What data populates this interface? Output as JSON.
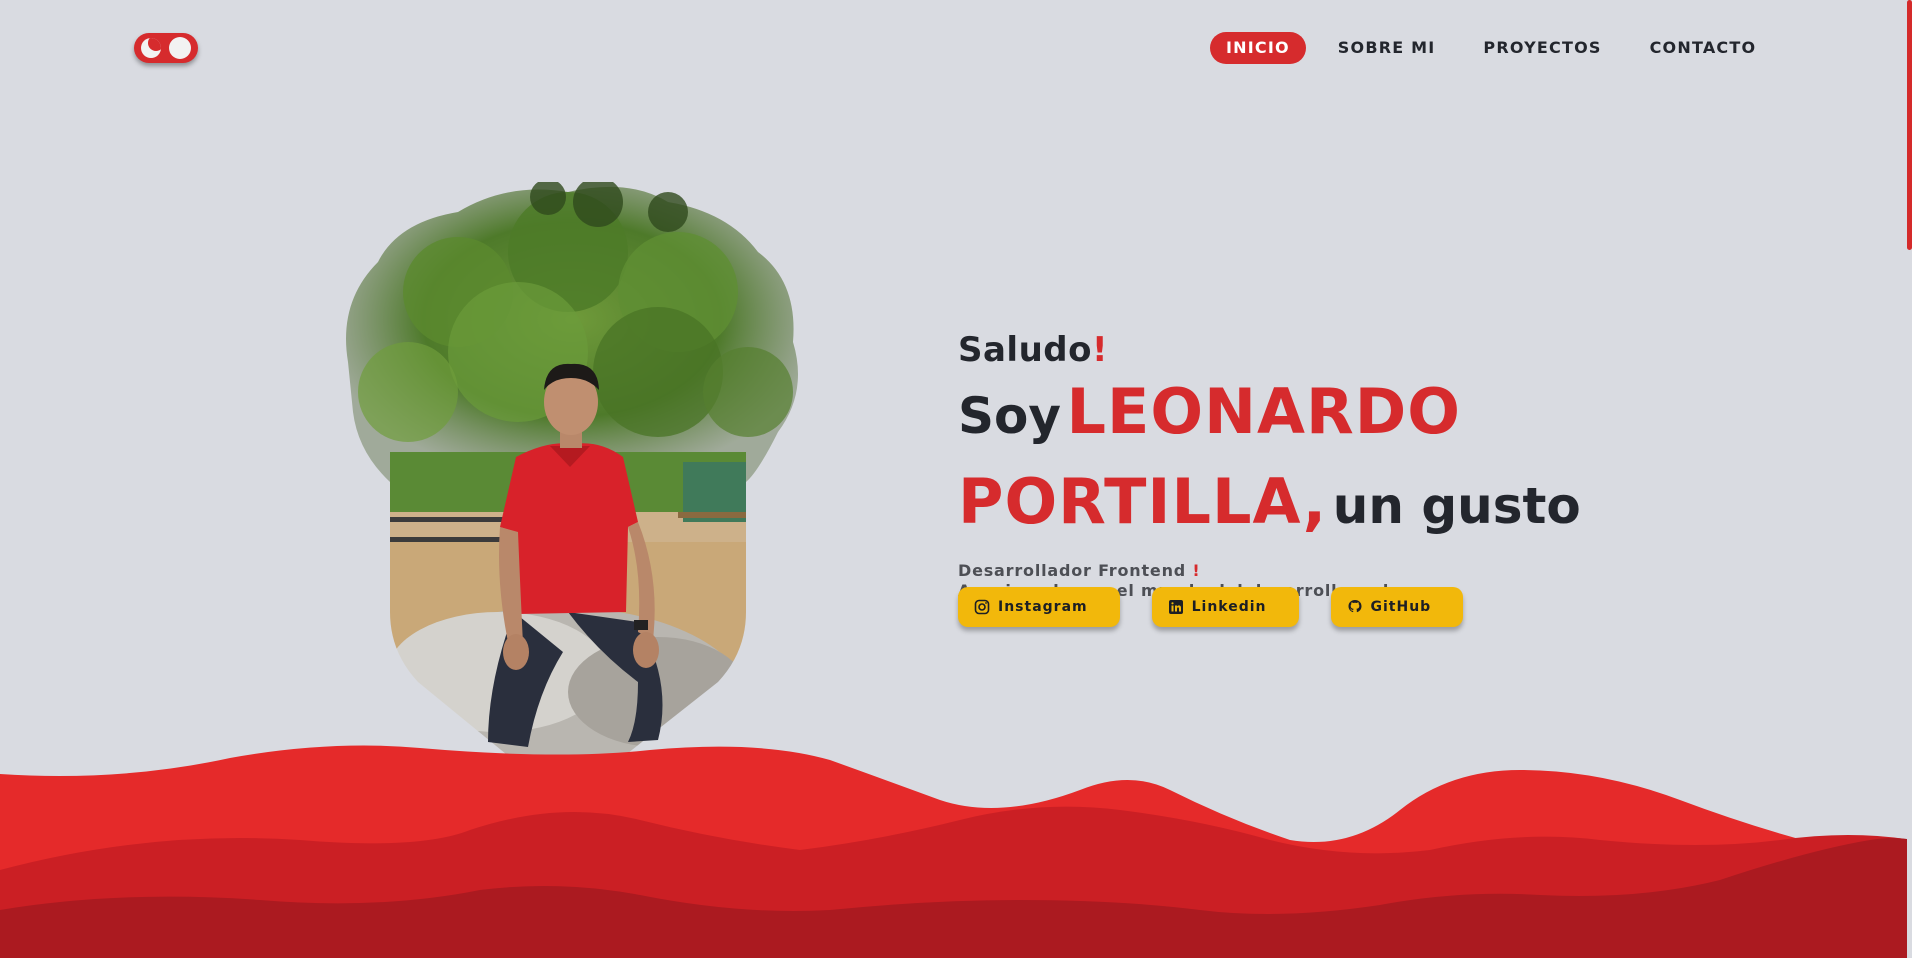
{
  "header": {
    "theme_toggle_label": "",
    "nav": [
      {
        "label": "INICIO",
        "active": true
      },
      {
        "label": "SOBRE MI",
        "active": false
      },
      {
        "label": "PROYECTOS",
        "active": false
      },
      {
        "label": "CONTACTO",
        "active": false
      }
    ]
  },
  "hero": {
    "greeting": "Saludo",
    "greeting_mark": "!",
    "intro_word": "Soy",
    "name_first": "LEONARDO",
    "name_last": "PORTILLA,",
    "closing": "un gusto",
    "role": "Desarrollador Frontend",
    "role_mark": "!",
    "tagline": "Apasionado por el mundo del desarrollo web."
  },
  "social": [
    {
      "label": "Instagram",
      "icon": "instagram-icon"
    },
    {
      "label": "Linkedin",
      "icon": "linkedin-icon"
    },
    {
      "label": "GitHub",
      "icon": "github-icon"
    }
  ],
  "colors": {
    "background": "#d9dbe1",
    "accent": "#d62b2d",
    "button": "#f2b80b",
    "text": "#23262d"
  }
}
